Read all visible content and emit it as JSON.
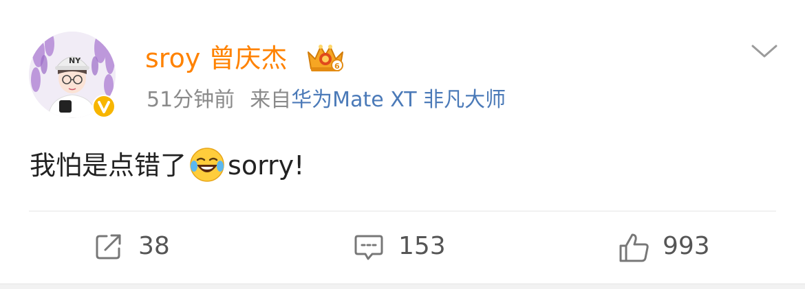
{
  "post": {
    "user": {
      "name": "sroy 曾庆杰",
      "avatar_icon": "avatar-cartoon-boy-cap",
      "verified_icon": "verified-v-badge",
      "badge_icon": "crown-level-6-badge"
    },
    "meta": {
      "time": "51分钟前",
      "source_prefix": "来自",
      "device": "华为Mate XT 非凡大师"
    },
    "content": {
      "text": "我怕是点错了",
      "emoji": "laugh-cry-emoji",
      "text_after": "sorry!"
    },
    "actions": {
      "repost_count": "38",
      "comment_count": "153",
      "like_count": "993"
    }
  },
  "colors": {
    "username": "#ff8200",
    "device_link": "#4b7ab8",
    "meta_gray": "#8a8a8a",
    "verified_gold": "#f7b500"
  }
}
